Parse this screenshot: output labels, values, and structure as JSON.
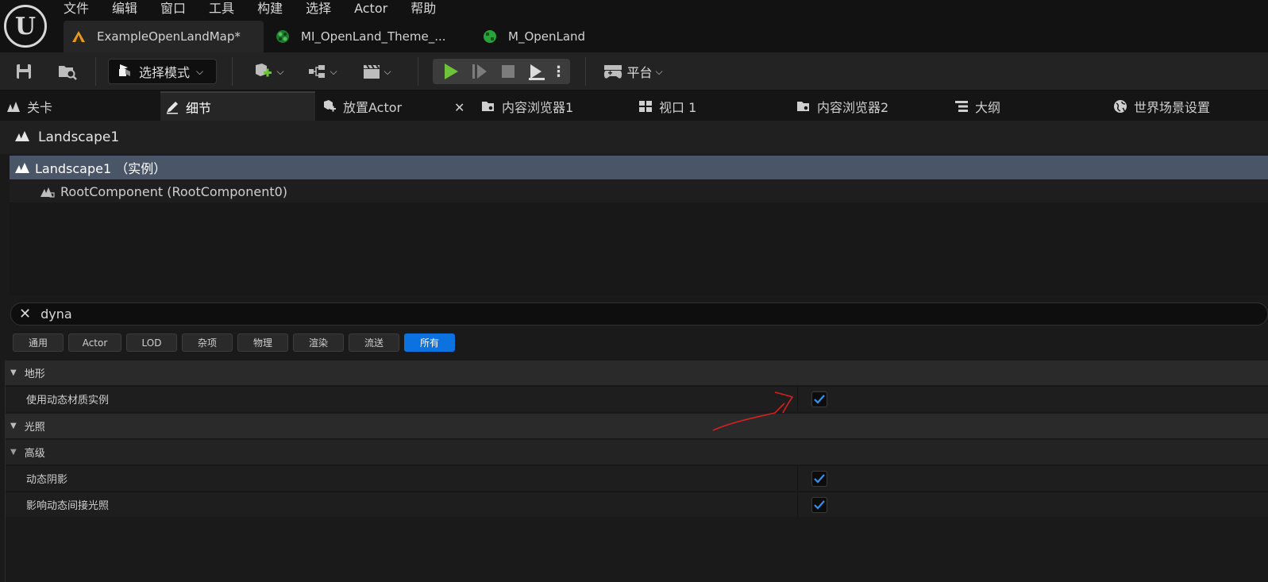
{
  "menu": [
    "文件",
    "编辑",
    "窗口",
    "工具",
    "构建",
    "选择",
    "Actor",
    "帮助"
  ],
  "doc_tabs": [
    {
      "label": "ExampleOpenLandMap*",
      "icon": "level-icon",
      "active": true
    },
    {
      "label": "MI_OpenLand_Theme_...",
      "icon": "material-instance-icon",
      "active": false
    },
    {
      "label": "M_OpenLand",
      "icon": "material-icon",
      "active": false
    }
  ],
  "toolbar": {
    "mode_label": "选择模式",
    "platform_label": "平台"
  },
  "panel_tabs": [
    {
      "label": "关卡",
      "icon": "levels-icon"
    },
    {
      "label": "细节",
      "icon": "details-icon",
      "active": true
    },
    {
      "label": "放置Actor",
      "icon": "place-actors-icon"
    },
    {
      "label": "内容浏览器1",
      "icon": "content-browser-icon"
    },
    {
      "label": "视口 1",
      "icon": "viewport-icon"
    },
    {
      "label": "内容浏览器2",
      "icon": "content-browser-icon"
    },
    {
      "label": "大纲",
      "icon": "outliner-icon"
    },
    {
      "label": "世界场景设置",
      "icon": "world-settings-icon"
    }
  ],
  "details": {
    "actor_name": "Landscape1",
    "tree_root": "Landscape1 （实例）",
    "tree_child": "RootComponent (RootComponent0)",
    "search_value": "dyna",
    "filters": [
      "通用",
      "Actor",
      "LOD",
      "杂项",
      "物理",
      "渲染",
      "流送",
      "所有"
    ],
    "active_filter": "所有",
    "categories": [
      {
        "label": "地形"
      },
      {
        "label": "光照"
      }
    ],
    "subcategory": "高级",
    "properties": [
      {
        "label": "使用动态材质实例",
        "checked": true
      },
      {
        "label": "动态阴影",
        "checked": true
      },
      {
        "label": "影响动态间接光照",
        "checked": true
      }
    ]
  },
  "colors": {
    "accent": "#0b72e0",
    "selection": "#4a5668",
    "play_green": "#6ec338",
    "annotation": "#d42020"
  }
}
